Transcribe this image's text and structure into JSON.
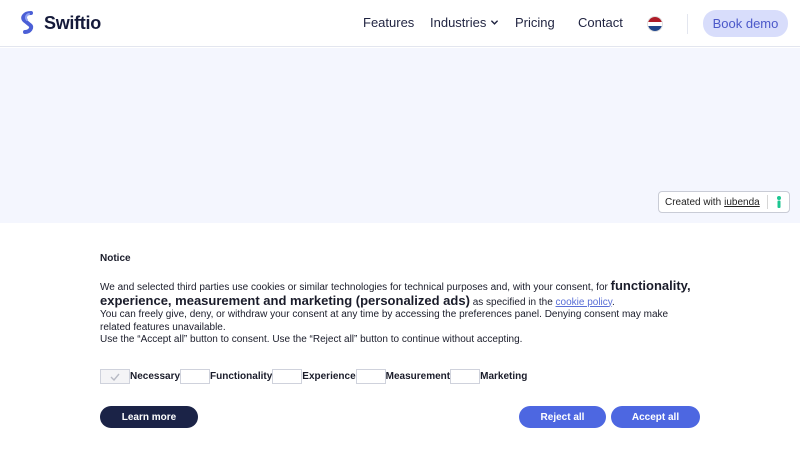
{
  "header": {
    "brand": "Swiftio",
    "nav": {
      "features": "Features",
      "industries": "Industries",
      "pricing": "Pricing",
      "contact": "Contact"
    },
    "language_flag": "netherlands-flag-icon",
    "book_demo": "Book demo"
  },
  "iubenda_badge": {
    "prefix": "Created with",
    "link": "iubenda"
  },
  "cookie_banner": {
    "title": "Notice",
    "text_intro": "We and selected third parties use cookies or similar technologies for technical purposes and, with your consent, for ",
    "text_purposes": "functionality, experience, measurement and marketing (personalized ads)",
    "text_specified": " as specified in the ",
    "cookie_policy_link": "cookie policy",
    "text_period": ".",
    "text_line2": "You can freely give, deny, or withdraw your consent at any time by accessing the preferences panel. Denying consent may make related features unavailable.",
    "text_line3": "Use the “Accept all” button to consent. Use the “Reject all” button to continue without accepting.",
    "purposes": [
      {
        "label": "Necessary",
        "checked": true
      },
      {
        "label": "Functionality",
        "checked": false
      },
      {
        "label": "Experience",
        "checked": false
      },
      {
        "label": "Measurement",
        "checked": false
      },
      {
        "label": "Marketing",
        "checked": false
      }
    ],
    "learn_more": "Learn more",
    "reject_all": "Reject all",
    "accept_all": "Accept all"
  },
  "colors": {
    "primary_button": "#4d67e1",
    "dark_button": "#1b2347",
    "hero_bg": "#f4f6fe",
    "book_demo_bg": "#d8ddfb"
  }
}
